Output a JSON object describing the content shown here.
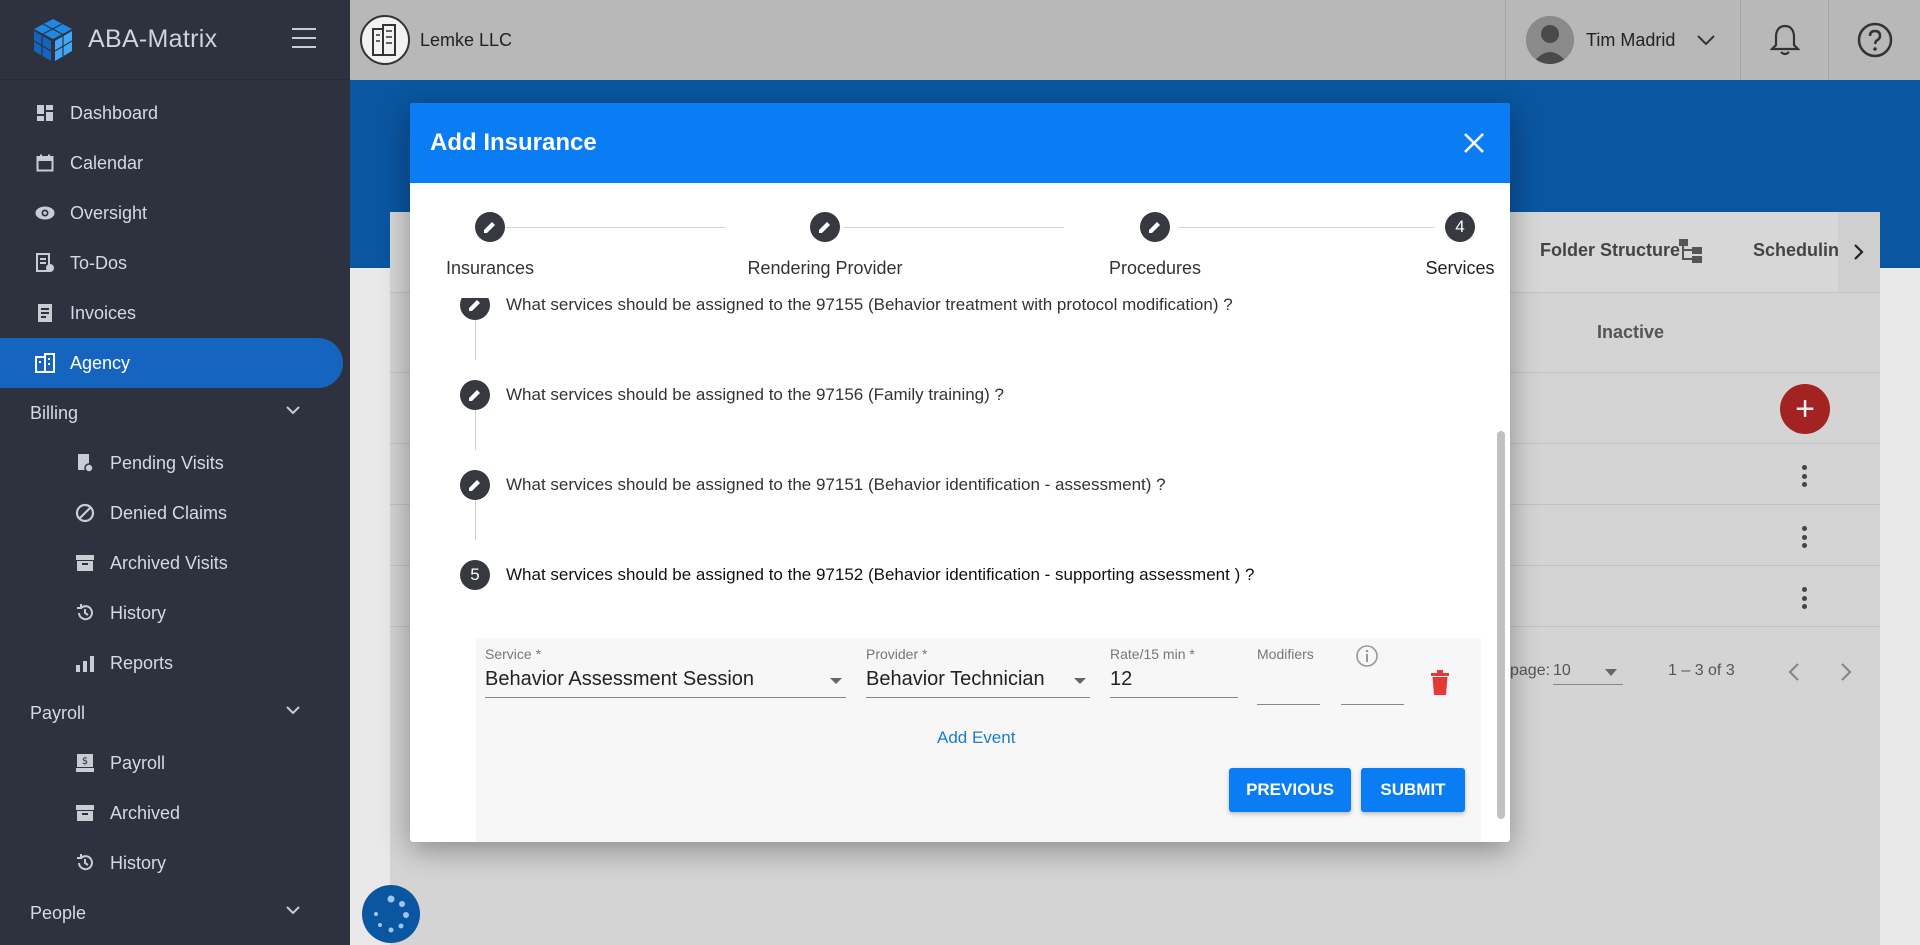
{
  "app": {
    "name": "ABA-Matrix"
  },
  "sidebar": {
    "items": [
      {
        "label": "Dashboard"
      },
      {
        "label": "Calendar"
      },
      {
        "label": "Oversight"
      },
      {
        "label": "To-Dos"
      },
      {
        "label": "Invoices"
      },
      {
        "label": "Agency"
      },
      {
        "label": "Billing"
      },
      {
        "label": "Pending Visits"
      },
      {
        "label": "Denied Claims"
      },
      {
        "label": "Archived Visits"
      },
      {
        "label": "History"
      },
      {
        "label": "Reports"
      },
      {
        "label": "Payroll"
      },
      {
        "label": "Payroll"
      },
      {
        "label": "Archived"
      },
      {
        "label": "History"
      },
      {
        "label": "People"
      }
    ]
  },
  "topbar": {
    "company": "Lemke LLC",
    "user": "Tim Madrid"
  },
  "background": {
    "tabs": {
      "folder": "Folder Structure",
      "scheduling": "Scheduling"
    },
    "column_inactive": "Inactive",
    "per_page_label": "page:",
    "per_page_value": "10",
    "range": "1 – 3 of 3"
  },
  "modal": {
    "title": "Add Insurance",
    "steps": [
      {
        "label": "Insurances"
      },
      {
        "label": "Rendering Provider"
      },
      {
        "label": "Procedures"
      },
      {
        "label": "Services",
        "number": "4"
      }
    ],
    "questions": [
      {
        "text": "What services should be assigned to the 97155 (Behavior treatment with protocol modification) ?"
      },
      {
        "text": "What services should be assigned to the 97156 (Family training) ?"
      },
      {
        "text": "What services should be assigned to the 97151 (Behavior identification - assessment) ?"
      },
      {
        "text": "What services should be assigned to the 97152 (Behavior identification - supporting assessment ) ?",
        "number": "5"
      }
    ],
    "form": {
      "service_label": "Service *",
      "service_value": "Behavior Assessment Session",
      "provider_label": "Provider *",
      "provider_value": "Behavior Technician",
      "rate_label": "Rate/15 min *",
      "rate_value": "12",
      "modifiers_label": "Modifiers",
      "add_event": "Add Event"
    },
    "buttons": {
      "previous": "PREVIOUS",
      "submit": "SUBMIT"
    }
  },
  "colors": {
    "sidebar": "#2d323e",
    "accent": "#0a7cf4",
    "active": "#1565c0",
    "danger": "#e53935"
  }
}
